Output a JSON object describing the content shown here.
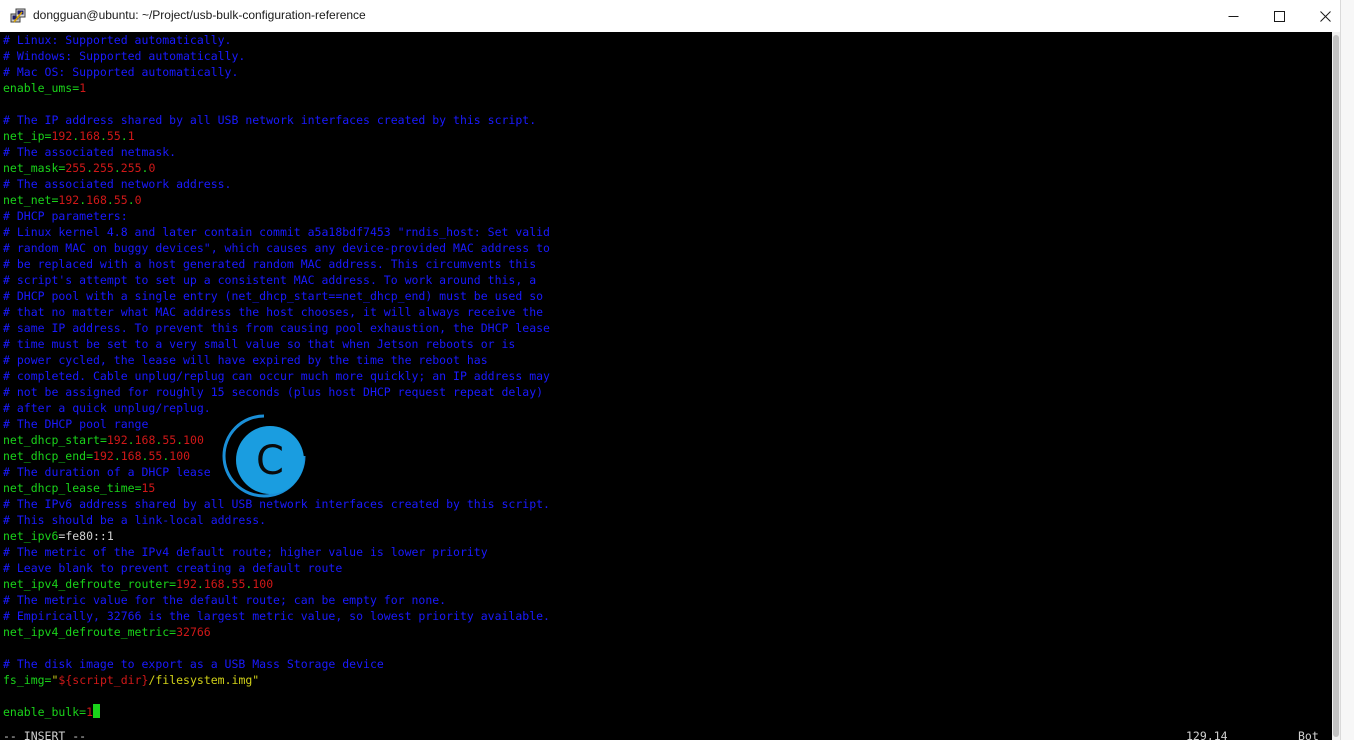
{
  "window": {
    "title": "dongguan@ubuntu: ~/Project/usb-bulk-configuration-reference",
    "app_icon": "putty-icon",
    "controls": [
      "minimize-icon",
      "maximize-icon",
      "close-icon"
    ]
  },
  "colors": {
    "comment": "#1a1aff",
    "key": "#1ad31a",
    "number": "#d01818",
    "string": "#d0d018",
    "background": "#000000"
  },
  "editor": {
    "lines": [
      [
        {
          "t": "# Linux: Supported automatically.",
          "c": "c"
        }
      ],
      [
        {
          "t": "# Windows: Supported automatically.",
          "c": "c"
        }
      ],
      [
        {
          "t": "# Mac OS: Supported automatically.",
          "c": "c"
        }
      ],
      [
        {
          "t": "enable_ums",
          "c": "k"
        },
        {
          "t": "=",
          "c": "k"
        },
        {
          "t": "1",
          "c": "n"
        }
      ],
      [],
      [
        {
          "t": "# The IP address shared by all USB network interfaces created by this script.",
          "c": "c"
        }
      ],
      [
        {
          "t": "net_ip",
          "c": "k"
        },
        {
          "t": "=",
          "c": "k"
        },
        {
          "t": "192",
          "c": "n"
        },
        {
          "t": ".",
          "c": "k"
        },
        {
          "t": "168",
          "c": "n"
        },
        {
          "t": ".",
          "c": "k"
        },
        {
          "t": "55",
          "c": "n"
        },
        {
          "t": ".",
          "c": "k"
        },
        {
          "t": "1",
          "c": "n"
        }
      ],
      [
        {
          "t": "# The associated netmask.",
          "c": "c"
        }
      ],
      [
        {
          "t": "net_mask",
          "c": "k"
        },
        {
          "t": "=",
          "c": "k"
        },
        {
          "t": "255",
          "c": "n"
        },
        {
          "t": ".",
          "c": "k"
        },
        {
          "t": "255",
          "c": "n"
        },
        {
          "t": ".",
          "c": "k"
        },
        {
          "t": "255",
          "c": "n"
        },
        {
          "t": ".",
          "c": "k"
        },
        {
          "t": "0",
          "c": "n"
        }
      ],
      [
        {
          "t": "# The associated network address.",
          "c": "c"
        }
      ],
      [
        {
          "t": "net_net",
          "c": "k"
        },
        {
          "t": "=",
          "c": "k"
        },
        {
          "t": "192",
          "c": "n"
        },
        {
          "t": ".",
          "c": "k"
        },
        {
          "t": "168",
          "c": "n"
        },
        {
          "t": ".",
          "c": "k"
        },
        {
          "t": "55",
          "c": "n"
        },
        {
          "t": ".",
          "c": "k"
        },
        {
          "t": "0",
          "c": "n"
        }
      ],
      [
        {
          "t": "# DHCP parameters:",
          "c": "c"
        }
      ],
      [
        {
          "t": "# Linux kernel 4.8 and later contain commit a5a18bdf7453 \"rndis_host: Set valid",
          "c": "c"
        }
      ],
      [
        {
          "t": "# random MAC on buggy devices\", which causes any device-provided MAC address to",
          "c": "c"
        }
      ],
      [
        {
          "t": "# be replaced with a host generated random MAC address. This circumvents this",
          "c": "c"
        }
      ],
      [
        {
          "t": "# script's attempt to set up a consistent MAC address. To work around this, a",
          "c": "c"
        }
      ],
      [
        {
          "t": "# DHCP pool with a single entry (net_dhcp_start==net_dhcp_end) must be used so",
          "c": "c"
        }
      ],
      [
        {
          "t": "# that no matter what MAC address the host chooses, it will always receive the",
          "c": "c"
        }
      ],
      [
        {
          "t": "# same IP address. To prevent this from causing pool exhaustion, the DHCP lease",
          "c": "c"
        }
      ],
      [
        {
          "t": "# time must be set to a very small value so that when Jetson reboots or is",
          "c": "c"
        }
      ],
      [
        {
          "t": "# power cycled, the lease will have expired by the time the reboot has",
          "c": "c"
        }
      ],
      [
        {
          "t": "# completed. Cable unplug/replug can occur much more quickly; an IP address may",
          "c": "c"
        }
      ],
      [
        {
          "t": "# not be assigned for roughly 15 seconds (plus host DHCP request repeat delay)",
          "c": "c"
        }
      ],
      [
        {
          "t": "# after a quick unplug/replug.",
          "c": "c"
        }
      ],
      [
        {
          "t": "# The DHCP pool range",
          "c": "c"
        }
      ],
      [
        {
          "t": "net_dhcp_start",
          "c": "k"
        },
        {
          "t": "=",
          "c": "k"
        },
        {
          "t": "192",
          "c": "n"
        },
        {
          "t": ".",
          "c": "k"
        },
        {
          "t": "168",
          "c": "n"
        },
        {
          "t": ".",
          "c": "k"
        },
        {
          "t": "55",
          "c": "n"
        },
        {
          "t": ".",
          "c": "k"
        },
        {
          "t": "100",
          "c": "n"
        }
      ],
      [
        {
          "t": "net_dhcp_end",
          "c": "k"
        },
        {
          "t": "=",
          "c": "k"
        },
        {
          "t": "192",
          "c": "n"
        },
        {
          "t": ".",
          "c": "k"
        },
        {
          "t": "168",
          "c": "n"
        },
        {
          "t": ".",
          "c": "k"
        },
        {
          "t": "55",
          "c": "n"
        },
        {
          "t": ".",
          "c": "k"
        },
        {
          "t": "100",
          "c": "n"
        }
      ],
      [
        {
          "t": "# The duration of a DHCP lease",
          "c": "c"
        }
      ],
      [
        {
          "t": "net_dhcp_lease_time",
          "c": "k"
        },
        {
          "t": "=",
          "c": "k"
        },
        {
          "t": "15",
          "c": "n"
        }
      ],
      [
        {
          "t": "# The IPv6 address shared by all USB network interfaces created by this script.",
          "c": "c"
        }
      ],
      [
        {
          "t": "# This should be a link-local address.",
          "c": "c"
        }
      ],
      [
        {
          "t": "net_ipv6",
          "c": "k"
        },
        {
          "t": "=fe80::1",
          "c": "w"
        }
      ],
      [
        {
          "t": "# The metric of the IPv4 default route; higher value is lower priority",
          "c": "c"
        }
      ],
      [
        {
          "t": "# Leave blank to prevent creating a default route",
          "c": "c"
        }
      ],
      [
        {
          "t": "net_ipv4_defroute_router",
          "c": "k"
        },
        {
          "t": "=",
          "c": "k"
        },
        {
          "t": "192",
          "c": "n"
        },
        {
          "t": ".",
          "c": "k"
        },
        {
          "t": "168",
          "c": "n"
        },
        {
          "t": ".",
          "c": "k"
        },
        {
          "t": "55",
          "c": "n"
        },
        {
          "t": ".",
          "c": "k"
        },
        {
          "t": "100",
          "c": "n"
        }
      ],
      [
        {
          "t": "# The metric value for the default route; can be empty for none.",
          "c": "c"
        }
      ],
      [
        {
          "t": "# Empirically, 32766 is the largest metric value, so lowest priority available.",
          "c": "c"
        }
      ],
      [
        {
          "t": "net_ipv4_defroute_metric",
          "c": "k"
        },
        {
          "t": "=",
          "c": "k"
        },
        {
          "t": "32766",
          "c": "n"
        }
      ],
      [],
      [
        {
          "t": "# The disk image to export as a USB Mass Storage device",
          "c": "c"
        }
      ],
      [
        {
          "t": "fs_img",
          "c": "k"
        },
        {
          "t": "=",
          "c": "k"
        },
        {
          "t": "\"",
          "c": "s"
        },
        {
          "t": "${script_dir}",
          "c": "n"
        },
        {
          "t": "/filesystem.img",
          "c": "s"
        },
        {
          "t": "\"",
          "c": "s"
        }
      ],
      [],
      [
        {
          "t": "enable_bulk",
          "c": "k"
        },
        {
          "t": "=",
          "c": "k"
        },
        {
          "t": "1",
          "c": "n"
        },
        {
          "t": "",
          "c": "cursor"
        }
      ]
    ]
  },
  "status": {
    "mode": "-- INSERT --",
    "position": "129,14",
    "scroll": "Bot"
  }
}
